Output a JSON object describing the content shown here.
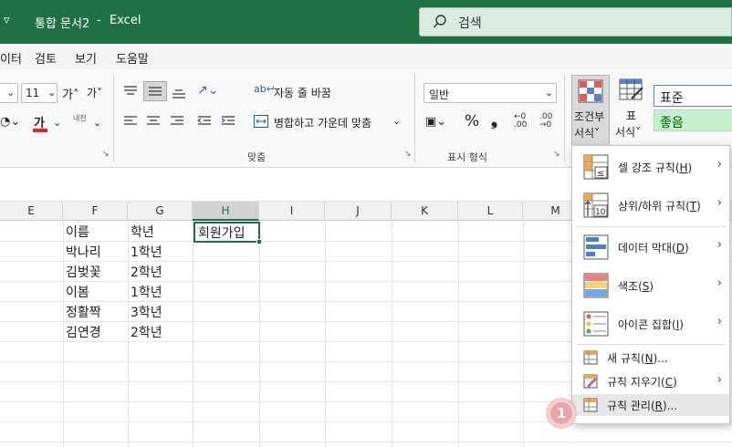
{
  "titlebar": {
    "quick_access": "▿",
    "document": "통합 문서2",
    "separator": "-",
    "app": "Excel",
    "search_placeholder": "검색"
  },
  "menu_tabs": [
    "이터",
    "검토",
    "보기",
    "도움말"
  ],
  "ribbon": {
    "font_size": "11",
    "font_grow": "가˄",
    "font_shrink": "가˅",
    "font_color_letter": "가",
    "phonetic_label": "내천",
    "wrap_text": "자동 줄 바꿈",
    "merge_center": "병합하고 가운데 맞춤",
    "alignment_group": "맞춤",
    "number_format": "일반",
    "number_group": "표시 형식",
    "percent": "%",
    "comma": "❟",
    "conditional_formatting": [
      "조건부",
      "서식˅"
    ],
    "format_as_table": [
      "표",
      "서식˅"
    ],
    "style_normal": "표준",
    "style_good": "좋음"
  },
  "columns": [
    "E",
    "F",
    "G",
    "H",
    "I",
    "J",
    "K",
    "L",
    "M"
  ],
  "selected_column": "H",
  "cells": {
    "f_col": [
      "이름",
      "박나리",
      "김벚꽃",
      "이봄",
      "정활짝",
      "김연경"
    ],
    "g_col": [
      "학년",
      "1학년",
      "2학년",
      "1학년",
      "3학년",
      "2학년"
    ],
    "h1": "회원가입"
  },
  "cf_menu": {
    "highlight_rules": {
      "label": "셀 강조 규칙(",
      "key": "H",
      "end": ")"
    },
    "top_bottom_rules": {
      "label": "상위/하위 규칙(",
      "key": "T",
      "end": ")"
    },
    "data_bars": {
      "label": "데이터 막대(",
      "key": "D",
      "end": ")"
    },
    "color_scales": {
      "label": "색조(",
      "key": "S",
      "end": ")"
    },
    "icon_sets": {
      "label": "아이콘 집합(",
      "key": "I",
      "end": ")"
    },
    "new_rule": {
      "label": "새 규칙(",
      "key": "N",
      "end": ")..."
    },
    "clear_rules": {
      "label": "규칙 지우기(",
      "key": "C",
      "end": ")"
    },
    "manage_rules": {
      "label": "규칙 관리(",
      "key": "R",
      "end": ")..."
    },
    "highlight_icon_text": "≤",
    "top_bottom_icon_text": "10"
  },
  "step_badge": "1",
  "colors": {
    "excel_green": "#1e7145",
    "good_style_bg": "#c6efce",
    "good_style_text": "#006100",
    "font_color_bar": "#e3242b"
  }
}
